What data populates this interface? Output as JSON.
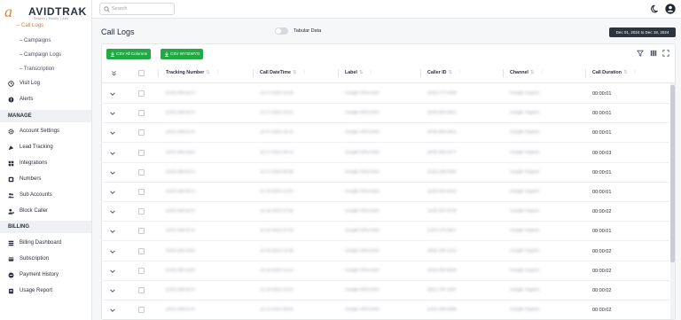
{
  "brand": {
    "mark": "a",
    "name": "AVIDTRAK",
    "tagline": "Search | Mobile | Ads"
  },
  "sidebar": {
    "sub_items": [
      "Call Logs",
      "Campaigns",
      "Campaign Logs",
      "Transcription"
    ],
    "items_top": [
      "Visit Log",
      "Alerts"
    ],
    "section_manage": "MANAGE",
    "items_manage": [
      "Account Settings",
      "Lead Tracking",
      "Integrations",
      "Numbers",
      "Sub Accounts",
      "Block Caller"
    ],
    "section_billing": "BILLING",
    "items_billing": [
      "Billing Dashboard",
      "Subscription",
      "Payment History",
      "Usage Report"
    ]
  },
  "topbar": {
    "search_placeholder": "Search"
  },
  "main": {
    "title": "Call Logs",
    "toggle_label": "Tabular Data",
    "toggle_on": false,
    "date_range": "Dec 01, 2024 to Dec 18, 2024",
    "buttons": {
      "csv_all": "CSV All Columns",
      "csv_wysiwyg": "CSV WYSIWYG"
    }
  },
  "table": {
    "columns": [
      "Tracking Number",
      "Call DateTime",
      "Label",
      "Caller ID",
      "Channel",
      "Call Duration"
    ],
    "rows": [
      {
        "tracking": "(210) 298-9172",
        "datetime": "12-17-2024 10:48",
        "label": "Google ORGANIC",
        "caller": "(210) 777-0308",
        "channel": "Google Organic",
        "duration": "00:00:01"
      },
      {
        "tracking": "(210) 298-9172",
        "datetime": "12-17-2024 10:12",
        "label": "Google ORGANIC",
        "caller": "(979) 650-6912",
        "channel": "Google Organic",
        "duration": "00:00:01"
      },
      {
        "tracking": "(210) 298-9172",
        "datetime": "12-17-2024 10:12",
        "label": "Google ORGANIC",
        "caller": "(979) 650-6912",
        "channel": "Google Organic",
        "duration": "00:00:01"
      },
      {
        "tracking": "(210) 298-1522",
        "datetime": "12-17-2024 09:14",
        "label": "Google ORGANIC",
        "caller": "(979) 383-3477",
        "channel": "Google Organic",
        "duration": "00:00:03"
      },
      {
        "tracking": "(210) 298-9172",
        "datetime": "12-17-2024 08:38",
        "label": "Google ORGANIC",
        "caller": "(210) 228-8394",
        "channel": "Google Organic",
        "duration": "00:00:01"
      },
      {
        "tracking": "(210) 298-9172",
        "datetime": "12-16-2024 11:03",
        "label": "Google ORGANIC",
        "caller": "(210) 842-5421",
        "channel": "Google Organic",
        "duration": "00:00:01"
      },
      {
        "tracking": "(210) 298-9172",
        "datetime": "12-16-2024 07:52",
        "label": "Google ORGANIC",
        "caller": "(210) 207-9718",
        "channel": "Google Organic",
        "duration": "00:00:02"
      },
      {
        "tracking": "(210) 298-9172",
        "datetime": "12-16-2024 07:03",
        "label": "Google ORGANIC",
        "caller": "(210) 278-5817",
        "channel": "Google Organic",
        "duration": "00:00:01"
      },
      {
        "tracking": "(210) 298-1522",
        "datetime": "12-15-2024 13:48",
        "label": "Google ORGANIC",
        "caller": "(409) 203-1413",
        "channel": "Google Organic",
        "duration": "00:00:02"
      },
      {
        "tracking": "(210) 298-1522",
        "datetime": "12-15-2024 12:12",
        "label": "Google ORGANIC",
        "caller": "(210) 382-8034",
        "channel": "Google Organic",
        "duration": "00:00:02"
      },
      {
        "tracking": "(210) 298-9172",
        "datetime": "12-15-2024 10:22",
        "label": "Google ORGANIC",
        "caller": "(361) 787-1187",
        "channel": "Google Organic",
        "duration": "00:00:02"
      },
      {
        "tracking": "(210) 298-9172",
        "datetime": "12-13-2024 08:54",
        "label": "Google ORGANIC",
        "caller": "(210) 299-5388",
        "channel": "Google Organic",
        "duration": "00:00:02"
      }
    ]
  },
  "colors": {
    "accent": "#e07a2e",
    "green": "#22a845",
    "dark_pill": "#2c3440"
  }
}
